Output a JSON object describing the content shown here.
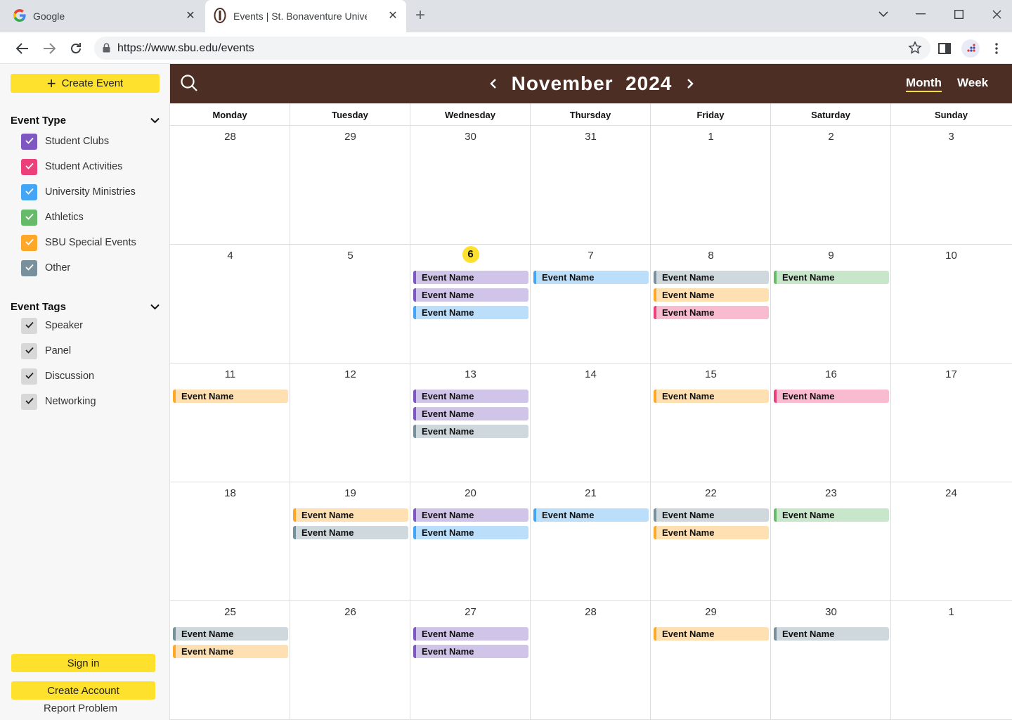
{
  "browser": {
    "tabs": [
      {
        "title": "Google",
        "active": false
      },
      {
        "title": "Events | St. Bonaventure University",
        "active": true
      }
    ],
    "url": "https://www.sbu.edu/events"
  },
  "sidebar": {
    "create_event_label": "Create Event",
    "event_type_heading": "Event Type",
    "event_types": [
      {
        "label": "Student Clubs",
        "color": "#7e57c2",
        "checked": true
      },
      {
        "label": "Student Activities",
        "color": "#ec407a",
        "checked": true
      },
      {
        "label": "University Ministries",
        "color": "#42a5f5",
        "checked": true
      },
      {
        "label": "Athletics",
        "color": "#66bb6a",
        "checked": true
      },
      {
        "label": "SBU Special Events",
        "color": "#ffa726",
        "checked": true
      },
      {
        "label": "Other",
        "color": "#78909c",
        "checked": true
      }
    ],
    "event_tags_heading": "Event Tags",
    "event_tags": [
      {
        "label": "Speaker",
        "checked": true
      },
      {
        "label": "Panel",
        "checked": true
      },
      {
        "label": "Discussion",
        "checked": true
      },
      {
        "label": "Networking",
        "checked": true
      }
    ],
    "sign_in_label": "Sign in",
    "create_account_label": "Create Account",
    "report_problem_label": "Report Problem"
  },
  "calendar": {
    "month": "November",
    "year": "2024",
    "views": {
      "month": "Month",
      "week": "Week",
      "active": "Month"
    },
    "weekdays": [
      "Monday",
      "Tuesday",
      "Wednesday",
      "Thursday",
      "Friday",
      "Saturday",
      "Sunday"
    ],
    "today": "6",
    "weeks": [
      [
        {
          "day": "28",
          "events": []
        },
        {
          "day": "29",
          "events": []
        },
        {
          "day": "30",
          "events": []
        },
        {
          "day": "31",
          "events": []
        },
        {
          "day": "1",
          "events": []
        },
        {
          "day": "2",
          "events": []
        },
        {
          "day": "3",
          "events": []
        }
      ],
      [
        {
          "day": "4",
          "events": []
        },
        {
          "day": "5",
          "events": []
        },
        {
          "day": "6",
          "events": [
            {
              "name": "Event Name",
              "type": "clubs"
            },
            {
              "name": "Event Name",
              "type": "clubs"
            },
            {
              "name": "Event Name",
              "type": "ministries"
            }
          ]
        },
        {
          "day": "7",
          "events": [
            {
              "name": "Event Name",
              "type": "ministries"
            }
          ]
        },
        {
          "day": "8",
          "events": [
            {
              "name": "Event Name",
              "type": "other"
            },
            {
              "name": "Event Name",
              "type": "special"
            },
            {
              "name": "Event Name",
              "type": "activities"
            }
          ]
        },
        {
          "day": "9",
          "events": [
            {
              "name": "Event Name",
              "type": "athletics"
            }
          ]
        },
        {
          "day": "10",
          "events": []
        }
      ],
      [
        {
          "day": "11",
          "events": [
            {
              "name": "Event Name",
              "type": "special"
            }
          ]
        },
        {
          "day": "12",
          "events": []
        },
        {
          "day": "13",
          "events": [
            {
              "name": "Event Name",
              "type": "clubs"
            },
            {
              "name": "Event Name",
              "type": "clubs"
            },
            {
              "name": "Event Name",
              "type": "other"
            }
          ]
        },
        {
          "day": "14",
          "events": []
        },
        {
          "day": "15",
          "events": [
            {
              "name": "Event Name",
              "type": "special"
            }
          ]
        },
        {
          "day": "16",
          "events": [
            {
              "name": "Event Name",
              "type": "activities"
            }
          ]
        },
        {
          "day": "17",
          "events": []
        }
      ],
      [
        {
          "day": "18",
          "events": []
        },
        {
          "day": "19",
          "events": [
            {
              "name": "Event Name",
              "type": "special"
            },
            {
              "name": "Event Name",
              "type": "other"
            }
          ]
        },
        {
          "day": "20",
          "events": [
            {
              "name": "Event Name",
              "type": "clubs"
            },
            {
              "name": "Event Name",
              "type": "ministries"
            }
          ]
        },
        {
          "day": "21",
          "events": [
            {
              "name": "Event Name",
              "type": "ministries"
            }
          ]
        },
        {
          "day": "22",
          "events": [
            {
              "name": "Event Name",
              "type": "other"
            },
            {
              "name": "Event Name",
              "type": "special"
            }
          ]
        },
        {
          "day": "23",
          "events": [
            {
              "name": "Event Name",
              "type": "athletics"
            }
          ]
        },
        {
          "day": "24",
          "events": []
        }
      ],
      [
        {
          "day": "25",
          "events": [
            {
              "name": "Event Name",
              "type": "other"
            },
            {
              "name": "Event Name",
              "type": "special"
            }
          ]
        },
        {
          "day": "26",
          "events": []
        },
        {
          "day": "27",
          "events": [
            {
              "name": "Event Name",
              "type": "clubs"
            },
            {
              "name": "Event Name",
              "type": "clubs"
            }
          ]
        },
        {
          "day": "28",
          "events": []
        },
        {
          "day": "29",
          "events": [
            {
              "name": "Event Name",
              "type": "special"
            }
          ]
        },
        {
          "day": "30",
          "events": [
            {
              "name": "Event Name",
              "type": "other"
            }
          ]
        },
        {
          "day": "1",
          "events": []
        }
      ]
    ]
  }
}
